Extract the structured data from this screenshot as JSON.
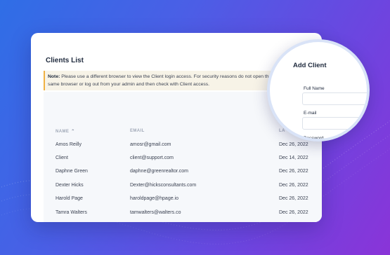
{
  "clients_card": {
    "title": "Clients List",
    "note_label": "Note:",
    "note_text": "Please use a different browser to view the Client login access. For security reasons do not open the Client access in the same browser or log out from your admin and then check with Client access."
  },
  "table": {
    "columns": [
      {
        "label": "NAME",
        "sort_icon": "caret-up-icon"
      },
      {
        "label": "EMAIL"
      },
      {
        "label": "LA"
      }
    ],
    "rows": [
      {
        "name": "Amos Reilly",
        "email": "amosr@gmail.com",
        "date": "Dec 26, 2022"
      },
      {
        "name": "Client",
        "email": "client@support.com",
        "date": "Dec 14, 2022"
      },
      {
        "name": "Daphne Green",
        "email": "daphne@greenrealtor.com",
        "date": "Dec 26, 2022"
      },
      {
        "name": "Dexter Hicks",
        "email": "Dexter@hicksconsultants.com",
        "date": "Dec 26, 2022"
      },
      {
        "name": "Harold Page",
        "email": "haroldpage@hpage.io",
        "date": "Dec 26, 2022"
      },
      {
        "name": "Tamra Walters",
        "email": "tamwalters@walters.co",
        "date": "Dec 26, 2022"
      }
    ]
  },
  "add_client": {
    "title": "Add Client",
    "full_name_label": "Full Name",
    "email_label": "E-mail",
    "password_label": "Password"
  },
  "colors": {
    "background_start": "#2f6ee6",
    "background_end": "#8a34d8",
    "note_accent": "#f0b143",
    "text_dark": "#1f2a3d"
  }
}
